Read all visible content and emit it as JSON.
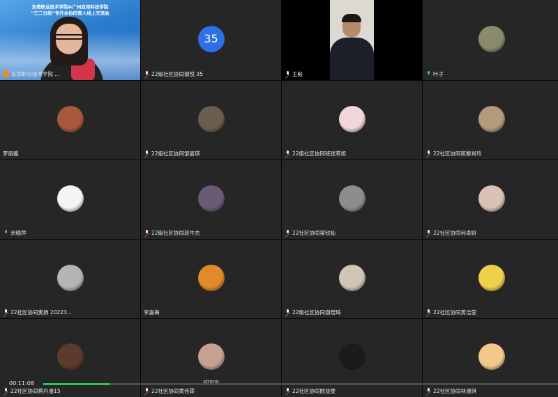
{
  "meeting": {
    "elapsed_time": "00:11:08",
    "progress_fraction": 0.13,
    "banner_line1": "东莞职业技术学院&广州应用科技学院",
    "banner_line2": "“三二分段”专升本协同育人线上交流会"
  },
  "participants": [
    {
      "name": "东莞职业技术学院 ...",
      "type": "presenter",
      "mic": "host"
    },
    {
      "name": "22级社区协同谢悦 35",
      "type": "number",
      "avatar_text": "35",
      "avatar_color": "#2d6fe6",
      "mic": "muted"
    },
    {
      "name": "王毅",
      "type": "camera",
      "mic": "muted"
    },
    {
      "name": "叶子",
      "type": "avatar",
      "avatar": "woman-field-photo",
      "avatar_color": "#8a8a6e",
      "mic": "on"
    },
    {
      "name": "罗丽媛",
      "type": "avatar",
      "avatar": "mountain-sunset-photo",
      "avatar_color": "#a9593a",
      "mic": "none"
    },
    {
      "name": "22级社区协同邹嘉琪",
      "type": "avatar",
      "avatar": "room-mirror-photo",
      "avatar_color": "#6d5d4f",
      "mic": "muted"
    },
    {
      "name": "22级社区协同班张荣旭",
      "type": "avatar",
      "avatar": "anime-girl-avatar",
      "avatar_color": "#f1d6dc",
      "mic": "muted"
    },
    {
      "name": "22社区协同班黎肖玲",
      "type": "avatar",
      "avatar": "cat-desk-photo",
      "avatar_color": "#b49a7c",
      "mic": "muted"
    },
    {
      "name": "余缅萍",
      "type": "avatar",
      "avatar": "cartoon-boy-avatar",
      "avatar_color": "#f4f4f4",
      "mic": "on"
    },
    {
      "name": "22级社区协同班牛杰",
      "type": "avatar",
      "avatar": "person-dusk-photo",
      "avatar_color": "#6b5a75",
      "mic": "muted"
    },
    {
      "name": "22社区协同梁钦灿",
      "type": "avatar",
      "avatar": "person-standing-photo",
      "avatar_color": "#8d8d8d",
      "mic": "muted"
    },
    {
      "name": "22社区协同何卓妍",
      "type": "avatar",
      "avatar": "girl-portrait-photo",
      "avatar_color": "#d9c2b4",
      "mic": "muted"
    },
    {
      "name": "22社区协同麦扬 20223...",
      "type": "avatar",
      "avatar": "silver-hair-portrait",
      "avatar_color": "#b5b5b5",
      "mic": "muted"
    },
    {
      "name": "李嘉梅",
      "type": "avatar",
      "avatar": "cartoon-dog-avatar",
      "avatar_color": "#e08a2a",
      "mic": "none"
    },
    {
      "name": "22级社区协同谢煜琦",
      "type": "avatar",
      "avatar": "girl-sky-photo",
      "avatar_color": "#cfc6b7",
      "mic": "muted"
    },
    {
      "name": "22社区协同黄洁莹",
      "type": "avatar",
      "avatar": "yellow-sticker-avatar",
      "avatar_color": "#f0cf4a",
      "mic": "muted"
    },
    {
      "name": "22社区协同蒋丹漫15",
      "type": "avatar",
      "avatar": "dark-food-photo",
      "avatar_color": "#5c3a2c",
      "mic": "muted"
    },
    {
      "name": "22社区协同黄佳霖",
      "type": "avatar",
      "avatar": "hand-photo",
      "avatar_color": "#c7a08f",
      "mic": "muted",
      "caption": "strong"
    },
    {
      "name": "22社区协同欧益雯",
      "type": "avatar",
      "avatar": "dark-text-avatar",
      "avatar_color": "#1b1b1b",
      "mic": "muted"
    },
    {
      "name": "22社区协同林漫琪",
      "type": "avatar",
      "avatar": "mushroom-cartoon-avatar",
      "avatar_color": "#f3c98b",
      "mic": "muted"
    }
  ]
}
